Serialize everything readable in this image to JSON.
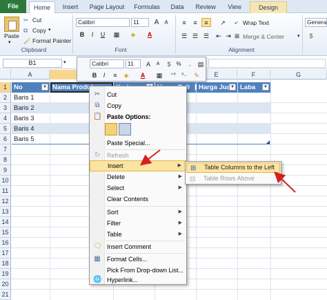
{
  "tabs": [
    "File",
    "Home",
    "Insert",
    "Page Layout",
    "Formulas",
    "Data",
    "Review",
    "View",
    "Design"
  ],
  "ribbon": {
    "paste": "Paste",
    "cut": "Cut",
    "copy": "Copy",
    "format_painter": "Format Painter",
    "clipboard": "Clipboard",
    "font_name": "Calibri",
    "font_size": "11",
    "font_group": "Font",
    "wrap_text": "Wrap Text",
    "merge_center": "Merge & Center",
    "alignment_group": "Alignment",
    "number_format": "General"
  },
  "name_box": "B1",
  "mini_toolbar": {
    "font_name": "Calibri",
    "font_size": "11"
  },
  "columns": [
    "A",
    "B",
    "C",
    "D",
    "E",
    "F",
    "G"
  ],
  "rows": [
    "1",
    "2",
    "3",
    "4",
    "5",
    "6",
    "7",
    "8",
    "9",
    "10",
    "11",
    "12",
    "13",
    "14",
    "15",
    "16",
    "17",
    "18",
    "19",
    "20",
    "21"
  ],
  "table": {
    "headers": [
      "No",
      "Nama Produk",
      "Kode",
      "Harga Beli",
      "Harga Jual",
      "Laba"
    ],
    "cells": [
      "Baris 1",
      "Baris 2",
      "Baris 3",
      "Baris 4",
      "Baris 5"
    ]
  },
  "context_menu": {
    "cut": "Cut",
    "copy": "Copy",
    "paste_options": "Paste Options:",
    "paste_special": "Paste Special...",
    "refresh": "Refresh",
    "insert": "Insert",
    "delete": "Delete",
    "select": "Select",
    "clear_contents": "Clear Contents",
    "sort": "Sort",
    "filter": "Filter",
    "table": "Table",
    "insert_comment": "Insert Comment",
    "format_cells": "Format Cells...",
    "pick_dropdown": "Pick From Drop-down List...",
    "hyperlink": "Hyperlink..."
  },
  "submenu": {
    "table_columns_left": "Table Columns to the Left",
    "table_rows_above": "Table Rows Above"
  },
  "colors": {
    "table_header": "#4f81bd",
    "band": "#dce6f2",
    "highlight": "#fbe4a2",
    "annotation_arrow": "#d42020"
  }
}
